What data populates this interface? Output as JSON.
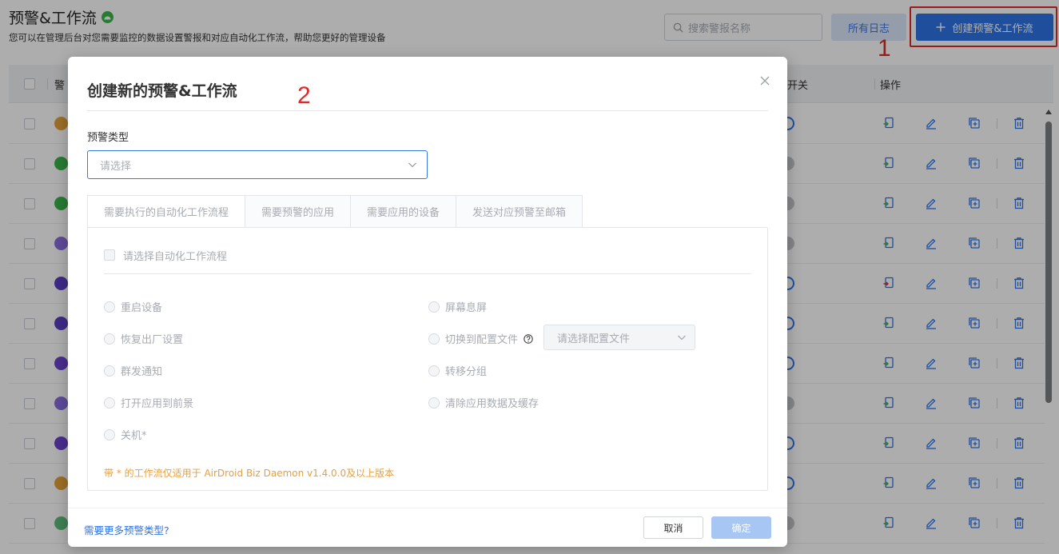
{
  "page": {
    "title": "预警&工作流",
    "description": "您可以在管理后台对您需要监控的数据设置警报和对应自动化工作流，帮助您更好的管理设备",
    "search_placeholder": "搜索警报名称",
    "logs_button": "所有日志",
    "create_button": "创建预警&工作流",
    "annotation_1": "1",
    "annotation_2": "2",
    "columns": {
      "alert_partial": "警",
      "switch_partial": "开关",
      "actions": "操作"
    },
    "rows": [
      {
        "icon_color": "#e6a33c",
        "switch": "on"
      },
      {
        "icon_color": "#3ab54a",
        "switch": "off"
      },
      {
        "icon_color": "#3ab54a",
        "switch": "off"
      },
      {
        "icon_color": "#8a6ee0",
        "switch": "off"
      },
      {
        "icon_color": "#5b3fc4",
        "switch": "on"
      },
      {
        "icon_color": "#5b3fc4",
        "switch": "on"
      },
      {
        "icon_color": "#6a45d0",
        "switch": "on"
      },
      {
        "icon_color": "#8a6ee0",
        "switch": "off"
      },
      {
        "icon_color": "#6a45d0",
        "switch": "on"
      },
      {
        "icon_color": "#e6a33c",
        "switch": "on"
      },
      {
        "icon_color": "#5fbf7a",
        "switch": "off"
      }
    ],
    "colors": {
      "primary": "#2f74e8",
      "annotation": "#e0292a",
      "warning_note": "#e5a041"
    }
  },
  "modal": {
    "title": "创建新的预警&工作流",
    "alert_type_label": "预警类型",
    "alert_type_placeholder": "请选择",
    "tabs": [
      "需要执行的自动化工作流程",
      "需要预警的应用",
      "需要应用的设备",
      "发送对应预警至邮箱"
    ],
    "select_workflow_label": "请选择自动化工作流程",
    "options_left": [
      "重启设备",
      "恢复出厂设置",
      "群发通知",
      "打开应用到前景",
      "关机*"
    ],
    "options_right": [
      "屏幕息屏",
      "切换到配置文件",
      "转移分组",
      "清除应用数据及缓存"
    ],
    "config_placeholder": "请选择配置文件",
    "note": "带 * 的工作流仅适用于 AirDroid Biz Daemon v1.4.0.0及以上版本",
    "more_types_link": "需要更多预警类型?",
    "cancel_button": "取消",
    "confirm_button": "确定"
  }
}
